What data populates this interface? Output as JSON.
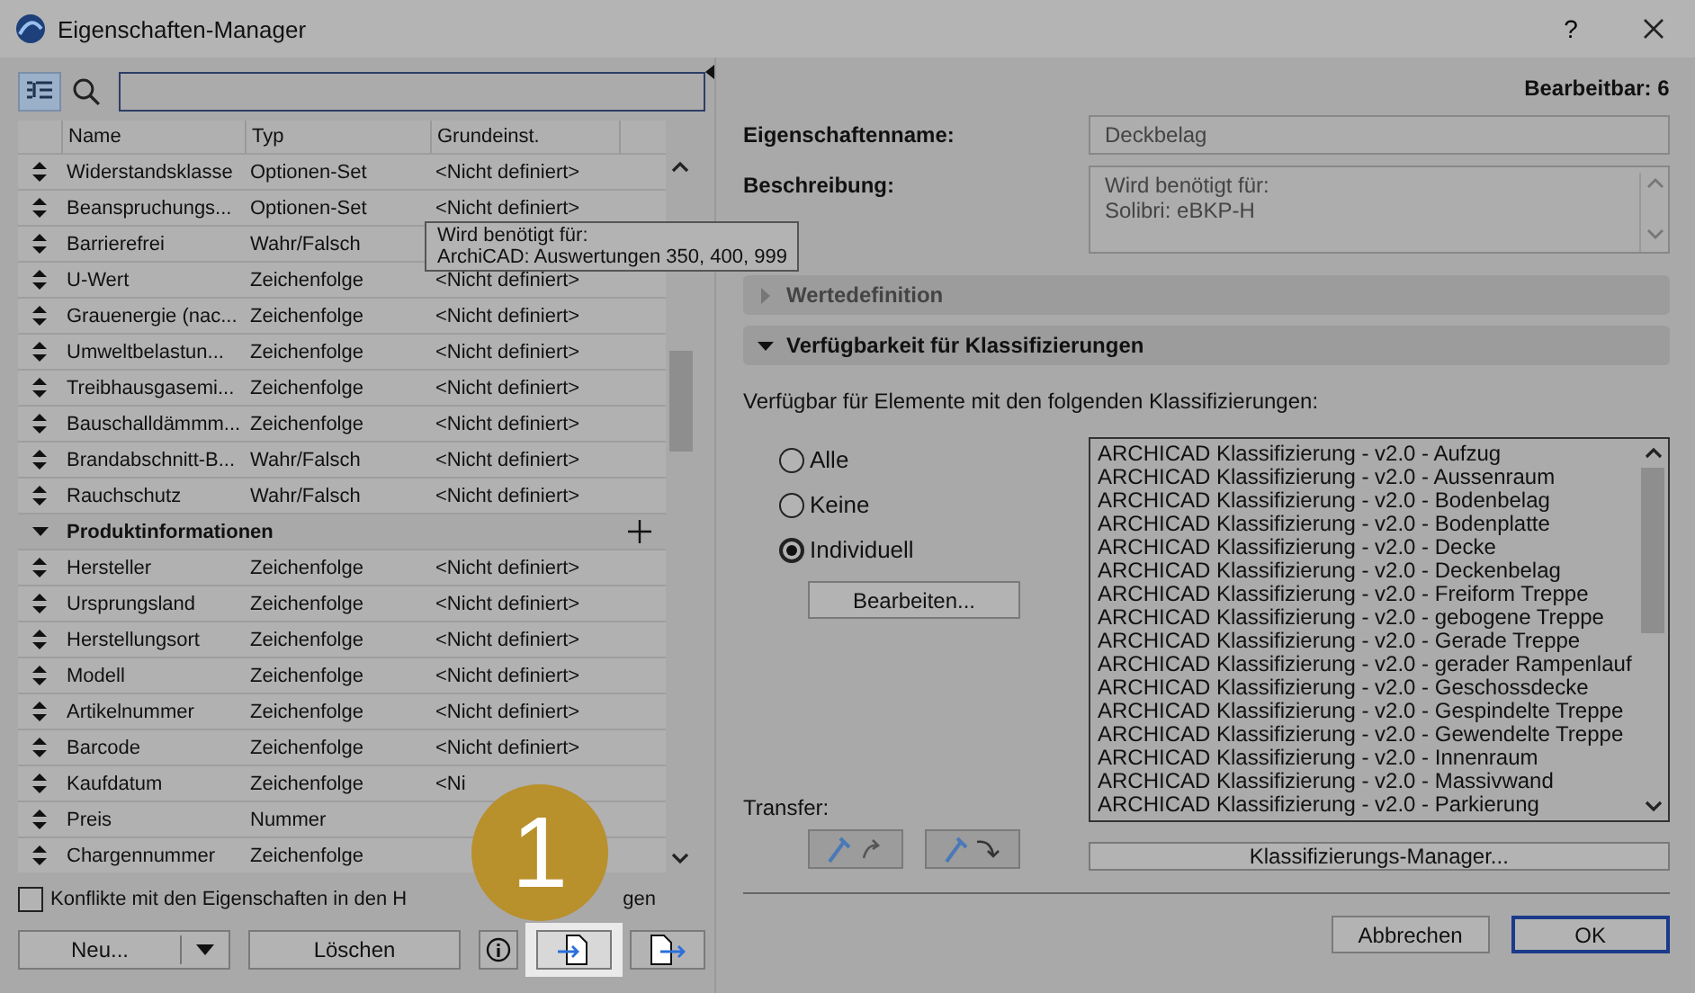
{
  "window": {
    "title": "Eigenschaften-Manager",
    "help": "?"
  },
  "left": {
    "view_toggle": {
      "selected": true
    },
    "table": {
      "columns": [
        "Name",
        "Typ",
        "Grundeinst."
      ],
      "rows": [
        {
          "kind": "row",
          "name": "Widerstandsklasse",
          "type": "Optionen-Set",
          "default": "<Nicht definiert>"
        },
        {
          "kind": "row",
          "name": "Beanspruchungs...",
          "type": "Optionen-Set",
          "default": "<Nicht definiert>"
        },
        {
          "kind": "row",
          "name": "Barrierefrei",
          "type": "Wahr/Falsch"
        },
        {
          "kind": "row",
          "name": "U-Wert",
          "type": "Zeichenfolge",
          "default": "<Nicht definiert>"
        },
        {
          "kind": "row",
          "name": "Grauenergie (nac...",
          "type": "Zeichenfolge",
          "default": "<Nicht definiert>"
        },
        {
          "kind": "row",
          "name": "Umweltbelastun...",
          "type": "Zeichenfolge",
          "default": "<Nicht definiert>"
        },
        {
          "kind": "row",
          "name": "Treibhausgasemi...",
          "type": "Zeichenfolge",
          "default": "<Nicht definiert>"
        },
        {
          "kind": "row",
          "name": "Bauschalldämmm...",
          "type": "Zeichenfolge",
          "default": "<Nicht definiert>"
        },
        {
          "kind": "row",
          "name": "Brandabschnitt-B...",
          "type": "Wahr/Falsch",
          "default": "<Nicht definiert>"
        },
        {
          "kind": "row",
          "name": "Rauchschutz",
          "type": "Wahr/Falsch",
          "default": "<Nicht definiert>"
        },
        {
          "kind": "group",
          "name": "Produktinformationen",
          "expanded": true
        },
        {
          "kind": "row",
          "name": "Hersteller",
          "type": "Zeichenfolge",
          "default": "<Nicht definiert>"
        },
        {
          "kind": "row",
          "name": "Ursprungsland",
          "type": "Zeichenfolge",
          "default": "<Nicht definiert>"
        },
        {
          "kind": "row",
          "name": "Herstellungsort",
          "type": "Zeichenfolge",
          "default": "<Nicht definiert>"
        },
        {
          "kind": "row",
          "name": "Modell",
          "type": "Zeichenfolge",
          "default": "<Nicht definiert>"
        },
        {
          "kind": "row",
          "name": "Artikelnummer",
          "type": "Zeichenfolge",
          "default": "<Nicht definiert>"
        },
        {
          "kind": "row",
          "name": "Barcode",
          "type": "Zeichenfolge",
          "default": "<Nicht definiert>"
        },
        {
          "kind": "row",
          "name": "Kaufdatum",
          "type": "Zeichenfolge",
          "default": "<Ni"
        },
        {
          "kind": "row",
          "name": "Preis",
          "type": "Nummer"
        },
        {
          "kind": "row",
          "name": "Chargennummer",
          "type": "Zeichenfolge"
        }
      ]
    },
    "tooltip": [
      "Wird benötigt für:",
      "ArchiCAD: Auswertungen 350, 400, 999"
    ],
    "conflicts": {
      "checked": false,
      "label": "Konflikte mit den Eigenschaften in den H",
      "label_end": "gen"
    },
    "buttons": {
      "new": "Neu...",
      "delete": "Löschen"
    }
  },
  "callout": {
    "number": "1"
  },
  "right": {
    "editable": "Bearbeitbar: 6",
    "name": {
      "label": "Eigenschaftenname:",
      "value": "Deckbelag"
    },
    "description": {
      "label": "Beschreibung:",
      "lines": [
        "Wird benötigt für:",
        "Solibri: eBKP-H"
      ]
    },
    "sections": [
      {
        "title": "Wertedefinition",
        "expanded": false
      },
      {
        "title": "Verfügbarkeit für Klassifizierungen",
        "expanded": true
      }
    ],
    "availability_text": "Verfügbar für Elemente mit den folgenden Klassifizierungen:",
    "radios": [
      {
        "label": "Alle",
        "selected": false
      },
      {
        "label": "Keine",
        "selected": false
      },
      {
        "label": "Individuell",
        "selected": true
      }
    ],
    "edit_button": "Bearbeiten...",
    "classifications": [
      "ARCHICAD Klassifizierung - v2.0 - Aufzug",
      "ARCHICAD Klassifizierung - v2.0 - Aussenraum",
      "ARCHICAD Klassifizierung - v2.0 - Bodenbelag",
      "ARCHICAD Klassifizierung - v2.0 - Bodenplatte",
      "ARCHICAD Klassifizierung - v2.0 - Decke",
      "ARCHICAD Klassifizierung - v2.0 - Deckenbelag",
      "ARCHICAD Klassifizierung - v2.0 - Freiform Treppe",
      "ARCHICAD Klassifizierung - v2.0 - gebogene Treppe",
      "ARCHICAD Klassifizierung - v2.0 - Gerade Treppe",
      "ARCHICAD Klassifizierung - v2.0 - gerader Rampenlauf",
      "ARCHICAD Klassifizierung - v2.0 - Geschossdecke",
      "ARCHICAD Klassifizierung - v2.0 - Gespindelte Treppe",
      "ARCHICAD Klassifizierung - v2.0 - Gewendelte Treppe",
      "ARCHICAD Klassifizierung - v2.0 - Innenraum",
      "ARCHICAD Klassifizierung - v2.0 - Massivwand",
      "ARCHICAD Klassifizierung - v2.0 - Parkierung"
    ],
    "transfer_label": "Transfer:",
    "manager_button": "Klassifizierungs-Manager...",
    "cancel": "Abbrechen",
    "ok": "OK"
  }
}
